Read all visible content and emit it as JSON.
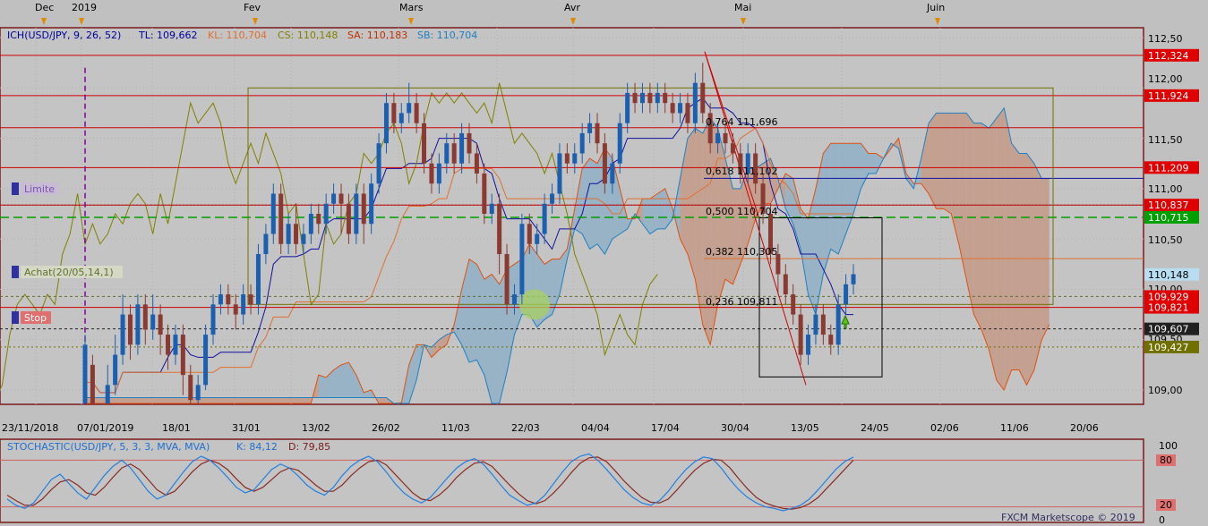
{
  "header": {
    "month_markers": [
      "Dec",
      "2019",
      "Fev",
      "Mars",
      "Avr",
      "Mai",
      "Juin"
    ]
  },
  "legend": {
    "ich": "ICH(USD/JPY, 9, 26, 52)",
    "tl": "TL: 109,662",
    "kl": "KL: 110,704",
    "cs": "CS: 110,148",
    "sa": "SA: 110,183",
    "sb": "SB: 110,704"
  },
  "orders": {
    "limit": "Limite",
    "buy": "Achat(20/05,14,1)",
    "stop": "Stop"
  },
  "fib": [
    "0,764 111,696",
    "0,618 111,102",
    "0,500 110,704",
    "0,382 110,305",
    "0,236 109,811"
  ],
  "price_axis": {
    "ticks": [
      "112,50",
      "112,00",
      "111,50",
      "111,00",
      "110,50",
      "110,00",
      "109,50",
      "109,00"
    ],
    "tags": [
      {
        "label": "112,324",
        "bg": "#e00000",
        "fg": "#ffffff"
      },
      {
        "label": "111,924",
        "bg": "#e00000",
        "fg": "#ffffff"
      },
      {
        "label": "111,209",
        "bg": "#e00000",
        "fg": "#ffffff"
      },
      {
        "label": "110,837",
        "bg": "#e00000",
        "fg": "#ffffff"
      },
      {
        "label": "110,715",
        "bg": "#00a000",
        "fg": "#ffffff"
      },
      {
        "label": "110,148",
        "bg": "#b8dcf0",
        "fg": "#000000"
      },
      {
        "label": "109,929",
        "bg": "#e00000",
        "fg": "#ffffff"
      },
      {
        "label": "109,821",
        "bg": "#e00000",
        "fg": "#ffffff"
      },
      {
        "label": "109,607",
        "bg": "#202020",
        "fg": "#ffffff"
      },
      {
        "label": "109,427",
        "bg": "#707000",
        "fg": "#ffffff"
      }
    ]
  },
  "date_axis": {
    "ticks": [
      "23/11/2018",
      "07/01/2019",
      "18/01",
      "31/01",
      "13/02",
      "26/02",
      "11/03",
      "22/03",
      "04/04",
      "17/04",
      "30/04",
      "13/05",
      "24/05",
      "02/06",
      "11/06",
      "20/06"
    ]
  },
  "stoch": {
    "title": "STOCHASTIC(USD/JPY, 5, 3, 3, MVA, MVA)",
    "k": "K: 84,12",
    "d": "D: 79,85",
    "axis": [
      "100",
      "80",
      "20",
      "0"
    ],
    "credit": "FXCM Marketscope © 2019"
  },
  "chart_data": {
    "type": "candlestick",
    "symbol": "USD/JPY",
    "ylim": [
      108.8,
      112.6
    ],
    "levels_red": [
      112.324,
      111.924,
      111.605,
      111.209,
      110.837,
      109.821
    ],
    "level_green": 110.715,
    "candles": [
      [
        108.7,
        109.45,
        108.6,
        109.55
      ],
      [
        109.25,
        108.7,
        108.6,
        109.35
      ],
      [
        108.7,
        108.55,
        108.4,
        108.8
      ],
      [
        108.8,
        109.05,
        108.7,
        109.25
      ],
      [
        109.05,
        109.35,
        108.95,
        109.55
      ],
      [
        109.35,
        109.75,
        109.25,
        109.95
      ],
      [
        109.75,
        109.45,
        109.3,
        109.85
      ],
      [
        109.45,
        109.85,
        109.35,
        109.95
      ],
      [
        109.85,
        109.6,
        109.45,
        109.95
      ],
      [
        109.6,
        109.75,
        109.5,
        109.95
      ],
      [
        109.75,
        109.55,
        109.35,
        109.85
      ],
      [
        109.55,
        109.35,
        109.2,
        109.65
      ],
      [
        109.35,
        109.55,
        109.25,
        109.65
      ],
      [
        109.55,
        109.15,
        108.95,
        109.65
      ],
      [
        109.15,
        108.9,
        108.75,
        109.25
      ],
      [
        108.9,
        109.05,
        108.7,
        109.15
      ],
      [
        109.05,
        109.55,
        109.0,
        109.65
      ],
      [
        109.55,
        109.85,
        109.45,
        109.95
      ],
      [
        109.85,
        109.95,
        109.75,
        110.05
      ],
      [
        109.95,
        109.85,
        109.75,
        110.05
      ],
      [
        109.85,
        109.75,
        109.6,
        109.95
      ],
      [
        109.75,
        109.95,
        109.65,
        110.05
      ],
      [
        109.95,
        109.85,
        109.75,
        110.05
      ],
      [
        109.85,
        110.35,
        109.75,
        110.45
      ],
      [
        110.35,
        110.55,
        110.25,
        110.65
      ],
      [
        110.55,
        110.95,
        110.45,
        111.05
      ],
      [
        110.95,
        110.45,
        110.35,
        111.05
      ],
      [
        110.45,
        110.65,
        110.35,
        110.75
      ],
      [
        110.65,
        110.45,
        110.35,
        110.85
      ],
      [
        110.45,
        110.55,
        110.35,
        110.65
      ],
      [
        110.55,
        110.75,
        110.45,
        110.85
      ],
      [
        110.75,
        110.65,
        110.55,
        110.85
      ],
      [
        110.65,
        110.85,
        110.55,
        110.95
      ],
      [
        110.85,
        110.95,
        110.75,
        111.05
      ],
      [
        110.95,
        110.85,
        110.55,
        111.05
      ],
      [
        110.85,
        110.55,
        110.45,
        110.95
      ],
      [
        110.55,
        110.95,
        110.45,
        111.05
      ],
      [
        110.95,
        110.65,
        110.45,
        111.05
      ],
      [
        110.65,
        111.05,
        110.55,
        111.15
      ],
      [
        111.05,
        111.45,
        110.95,
        111.55
      ],
      [
        111.45,
        111.85,
        111.35,
        111.95
      ],
      [
        111.85,
        111.65,
        111.55,
        111.95
      ],
      [
        111.65,
        111.75,
        111.55,
        111.85
      ],
      [
        111.75,
        111.85,
        111.65,
        112.05
      ],
      [
        111.85,
        111.65,
        111.55,
        111.95
      ],
      [
        111.65,
        111.25,
        111.15,
        111.75
      ],
      [
        111.25,
        111.05,
        110.95,
        111.35
      ],
      [
        111.05,
        111.25,
        110.95,
        111.35
      ],
      [
        111.25,
        111.45,
        111.15,
        111.55
      ],
      [
        111.45,
        111.25,
        111.15,
        111.55
      ],
      [
        111.25,
        111.55,
        111.15,
        111.65
      ],
      [
        111.55,
        111.35,
        111.25,
        111.65
      ],
      [
        111.35,
        111.15,
        111.05,
        111.45
      ],
      [
        111.15,
        110.75,
        110.65,
        111.25
      ],
      [
        110.75,
        110.85,
        110.65,
        110.95
      ],
      [
        110.85,
        110.35,
        110.15,
        110.95
      ],
      [
        110.35,
        109.85,
        109.75,
        110.45
      ],
      [
        109.85,
        109.95,
        109.75,
        110.05
      ],
      [
        109.95,
        110.65,
        109.85,
        110.75
      ],
      [
        110.65,
        110.45,
        110.35,
        110.75
      ],
      [
        110.45,
        110.55,
        110.35,
        110.65
      ],
      [
        110.55,
        110.85,
        110.45,
        110.95
      ],
      [
        110.85,
        110.95,
        110.75,
        111.05
      ],
      [
        110.95,
        111.35,
        110.85,
        111.45
      ],
      [
        111.35,
        111.25,
        111.15,
        111.45
      ],
      [
        111.25,
        111.35,
        111.15,
        111.45
      ],
      [
        111.35,
        111.55,
        111.25,
        111.65
      ],
      [
        111.55,
        111.65,
        111.45,
        111.75
      ],
      [
        111.65,
        111.45,
        111.35,
        111.75
      ],
      [
        111.45,
        111.05,
        110.95,
        111.55
      ],
      [
        111.05,
        111.25,
        110.95,
        111.35
      ],
      [
        111.25,
        111.65,
        111.15,
        111.75
      ],
      [
        111.65,
        111.95,
        111.55,
        112.05
      ],
      [
        111.95,
        111.85,
        111.75,
        112.05
      ],
      [
        111.85,
        111.95,
        111.75,
        112.05
      ],
      [
        111.95,
        111.85,
        111.75,
        112.05
      ],
      [
        111.85,
        111.95,
        111.75,
        112.05
      ],
      [
        111.95,
        111.85,
        111.75,
        112.05
      ],
      [
        111.85,
        111.75,
        111.65,
        111.95
      ],
      [
        111.75,
        111.85,
        111.65,
        111.95
      ],
      [
        111.85,
        111.65,
        111.55,
        111.95
      ],
      [
        111.65,
        112.05,
        111.55,
        112.15
      ],
      [
        112.05,
        111.75,
        111.65,
        112.25
      ],
      [
        111.75,
        111.45,
        111.35,
        111.85
      ],
      [
        111.45,
        111.55,
        111.35,
        111.65
      ],
      [
        111.55,
        111.45,
        111.35,
        111.65
      ],
      [
        111.45,
        111.35,
        111.25,
        111.55
      ],
      [
        111.35,
        111.15,
        111.05,
        111.45
      ],
      [
        111.15,
        111.35,
        111.05,
        111.45
      ],
      [
        111.35,
        111.05,
        110.95,
        111.45
      ],
      [
        111.05,
        110.75,
        110.65,
        111.15
      ],
      [
        110.75,
        110.35,
        110.25,
        110.85
      ],
      [
        110.35,
        110.15,
        109.95,
        110.45
      ],
      [
        110.15,
        109.95,
        109.85,
        110.25
      ],
      [
        109.95,
        109.75,
        109.65,
        110.05
      ],
      [
        109.75,
        109.35,
        109.25,
        109.85
      ],
      [
        109.35,
        109.55,
        109.25,
        109.65
      ],
      [
        109.55,
        109.75,
        109.45,
        109.85
      ],
      [
        109.75,
        109.55,
        109.45,
        109.85
      ],
      [
        109.55,
        109.45,
        109.35,
        109.65
      ],
      [
        109.45,
        109.85,
        109.35,
        109.95
      ],
      [
        109.85,
        110.05,
        109.75,
        110.15
      ],
      [
        110.05,
        110.15,
        109.95,
        110.25
      ]
    ],
    "stoch_k": [
      30,
      22,
      18,
      25,
      40,
      55,
      62,
      50,
      38,
      30,
      45,
      60,
      72,
      80,
      70,
      55,
      40,
      30,
      35,
      50,
      65,
      78,
      85,
      80,
      70,
      58,
      45,
      38,
      42,
      55,
      68,
      75,
      70,
      60,
      48,
      40,
      35,
      45,
      60,
      72,
      80,
      85,
      78,
      65,
      50,
      38,
      30,
      25,
      32,
      45,
      58,
      70,
      78,
      82,
      75,
      62,
      48,
      35,
      28,
      22,
      25,
      35,
      50,
      65,
      78,
      85,
      88,
      80,
      68,
      55,
      42,
      32,
      25,
      22,
      28,
      40,
      55,
      68,
      78,
      84,
      82,
      70,
      55,
      42,
      32,
      25,
      20,
      18,
      15,
      18,
      22,
      30,
      42,
      55,
      68,
      78,
      84
    ],
    "stoch_d": [
      35,
      28,
      22,
      22,
      30,
      42,
      52,
      55,
      48,
      38,
      35,
      45,
      58,
      70,
      75,
      68,
      55,
      42,
      35,
      40,
      52,
      65,
      75,
      80,
      76,
      68,
      56,
      45,
      40,
      45,
      55,
      65,
      70,
      67,
      58,
      48,
      40,
      40,
      48,
      60,
      70,
      78,
      80,
      74,
      62,
      50,
      38,
      30,
      28,
      35,
      45,
      58,
      68,
      76,
      78,
      72,
      60,
      48,
      37,
      28,
      24,
      28,
      38,
      50,
      64,
      76,
      83,
      84,
      78,
      66,
      53,
      42,
      32,
      26,
      25,
      30,
      42,
      55,
      67,
      76,
      81,
      80,
      70,
      56,
      43,
      32,
      25,
      21,
      18,
      17,
      19,
      24,
      32,
      44,
      56,
      68,
      80
    ]
  }
}
